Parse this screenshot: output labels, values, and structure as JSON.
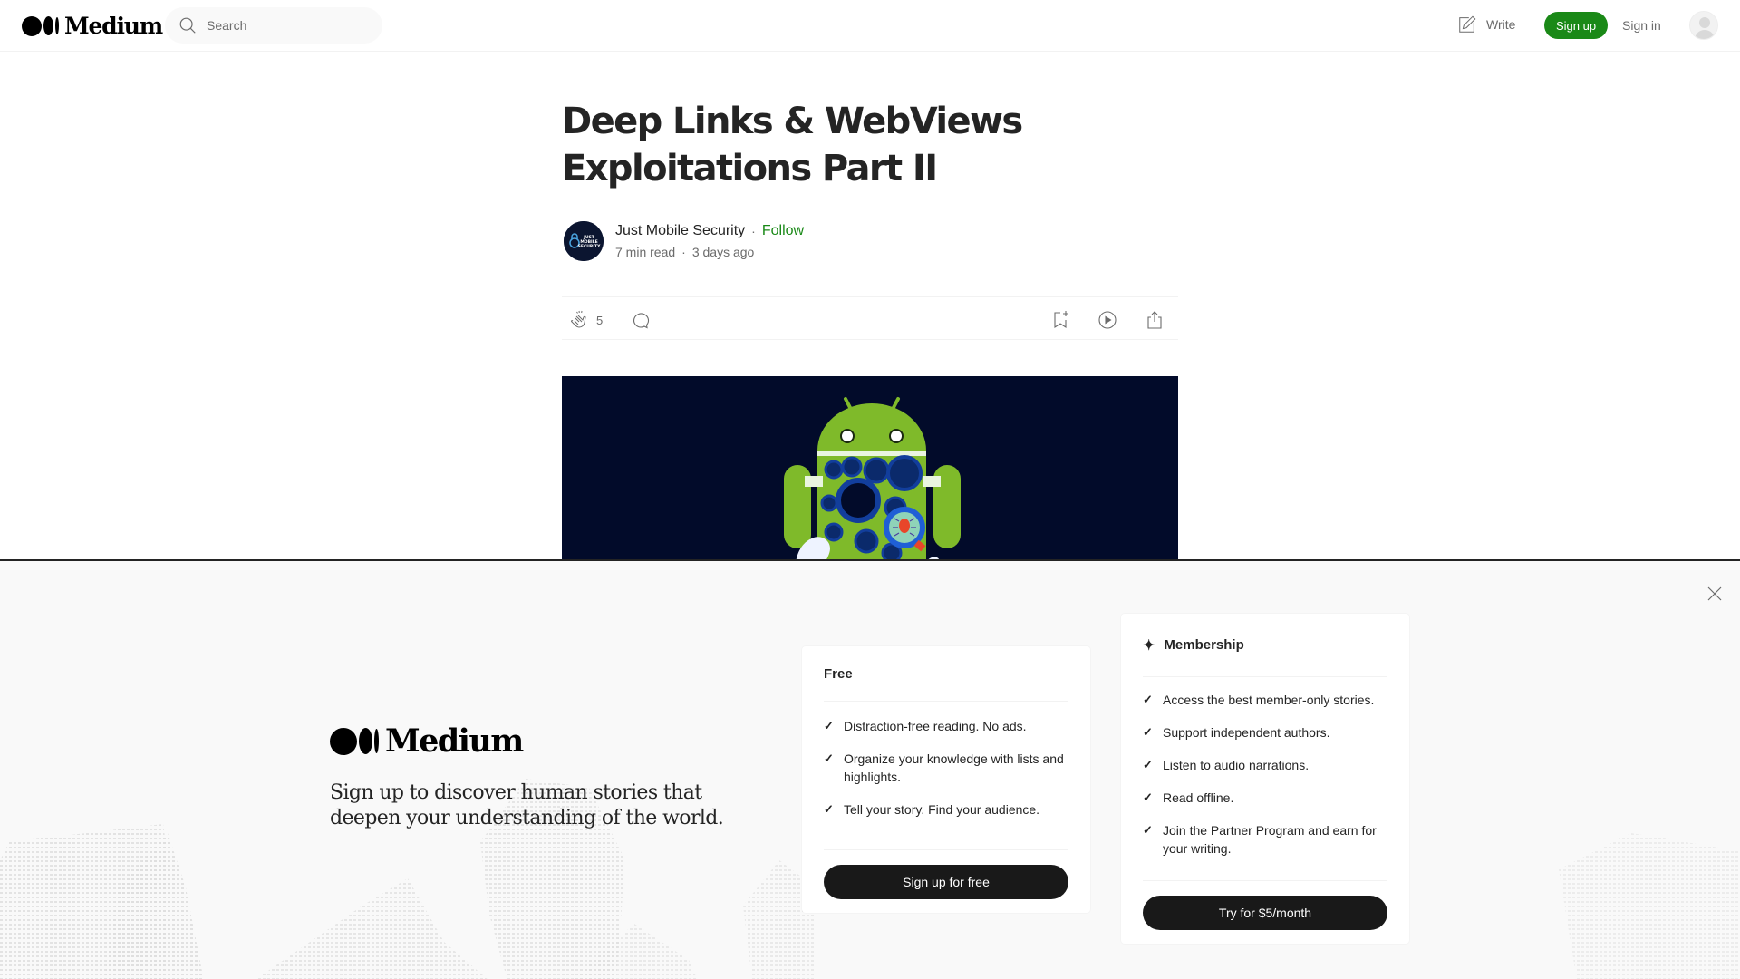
{
  "header": {
    "logo_text": "Medium",
    "search_placeholder": "Search",
    "write_label": "Write",
    "signup_label": "Sign up",
    "signin_label": "Sign in"
  },
  "article": {
    "title": "Deep Links & WebViews Exploitations Part II",
    "author": {
      "name": "Just Mobile Security",
      "avatar_text": "JUST MOBILE SECURITY",
      "follow_label": "Follow"
    },
    "read_time": "7 min read",
    "published": "3 days ago",
    "claps": "5",
    "hero_alt": "Android robot with magnifying glass inspecting a bug"
  },
  "signup_overlay": {
    "brand": "Medium",
    "tagline": "Sign up to discover human stories that deepen your understanding of the world.",
    "free": {
      "title": "Free",
      "features": [
        "Distraction-free reading. No ads.",
        "Organize your knowledge with lists and highlights.",
        "Tell your story. Find your audience."
      ],
      "cta": "Sign up for free"
    },
    "membership": {
      "title": "Membership",
      "features": [
        "Access the best member-only stories.",
        "Support independent authors.",
        "Listen to audio narrations.",
        "Read offline.",
        "Join the Partner Program and earn for your writing."
      ],
      "cta": "Try for $5/month"
    }
  },
  "colors": {
    "accent_green": "#1a8917",
    "text_primary": "#242424",
    "text_secondary": "#6b6b6b",
    "button_dark": "#191919",
    "overlay_bg": "#f9f9f9",
    "hero_bg": "#020b2a"
  }
}
